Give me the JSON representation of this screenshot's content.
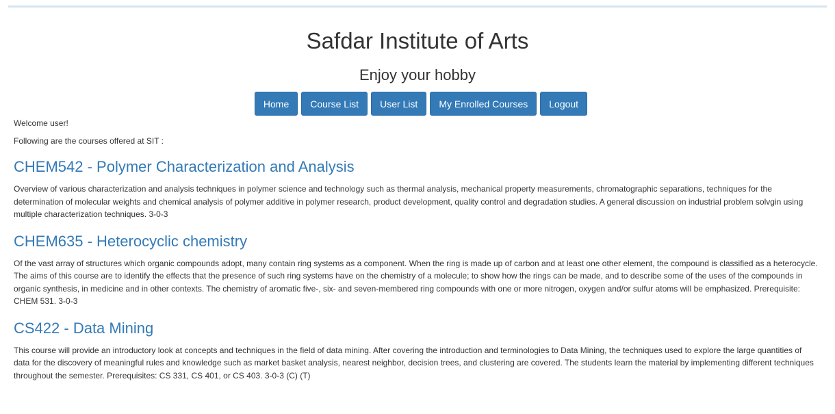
{
  "header": {
    "title": "Safdar Institute of Arts",
    "subtitle": "Enjoy your hobby"
  },
  "nav": {
    "home": "Home",
    "course_list": "Course List",
    "user_list": "User List",
    "my_enrolled": "My Enrolled Courses",
    "logout": "Logout"
  },
  "main": {
    "welcome": "Welcome user!",
    "intro": "Following are the courses offered at SIT :",
    "courses": [
      {
        "title": "CHEM542 - Polymer Characterization and Analysis",
        "description": "Overview of various characterization and analysis techniques in polymer science and technology such as thermal analysis, mechanical property measurements, chromatographic separations, techniques for the determination of molecular weights and chemical analysis of polymer additive in polymer research, product development, quality control and degradation studies. A general discussion on industrial problem solvgin using multiple characterization techniques. 3-0-3"
      },
      {
        "title": "CHEM635 - Heterocyclic chemistry",
        "description": "Of the vast array of structures which organic compounds adopt, many contain ring systems as a component. When the ring is made up of carbon and at least one other element, the compound is classified as a heterocycle. The aims of this course are to identify the effects that the presence of such ring systems have on the chemistry of a molecule; to show how the rings can be made, and to describe some of the uses of the compounds in organic synthesis, in medicine and in other contexts. The chemistry of aromatic five-, six- and seven-membered ring compounds with one or more nitrogen, oxygen and/or sulfur atoms will be emphasized. Prerequisite: CHEM 531. 3-0-3"
      },
      {
        "title": "CS422 - Data Mining",
        "description": "This course will provide an introductory look at concepts and techniques in the field of data mining. After covering the introduction and terminologies to Data Mining, the techniques used to explore the large quantities of data for the discovery of meaningful rules and knowledge such as market basket analysis, nearest neighbor, decision trees, and clustering are covered. The students learn the material by implementing different techniques throughout the semester. Prerequisites: CS 331, CS 401, or CS 403. 3-0-3 (C) (T)"
      }
    ]
  }
}
